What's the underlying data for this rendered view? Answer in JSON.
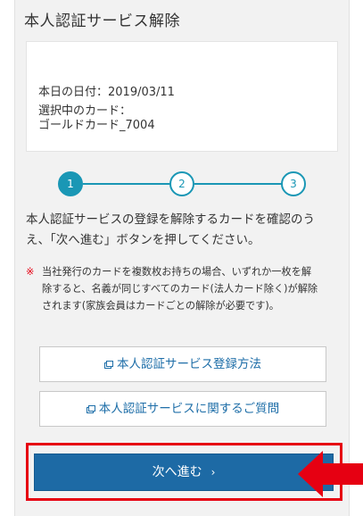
{
  "page": {
    "title": "本人認証サービス解除"
  },
  "info": {
    "date_line": "本日の日付：2019/03/11",
    "card_label": "選択中のカード：",
    "card_name": "ゴールドカード_7004"
  },
  "steps": [
    {
      "label": "1",
      "active": true
    },
    {
      "label": "2",
      "active": false
    },
    {
      "label": "3",
      "active": false
    }
  ],
  "description": {
    "line1": "本人認証サービスの登録を解除するカードを確認のう",
    "line2": "え、「次へ進む」ボタンを押してください。"
  },
  "note": {
    "mark": "※",
    "line1": "当社発行のカードを複数枚お持ちの場合、いずれか一枚を解",
    "line2": "除すると、名義が同じすべてのカード(法人カード除く)が解除",
    "line3": "されます(家族会員はカードごとの解除が必要です)。"
  },
  "links": {
    "registration_method": "本人認証サービス登録方法",
    "faq": "本人認証サービスに関するご質問"
  },
  "actions": {
    "next_label": "次へ進む",
    "next_chevron": "›"
  },
  "colors": {
    "accent": "#1a97b5",
    "primary_button": "#1d6aa5",
    "link": "#1e6ea8",
    "highlight": "#e60012",
    "panel_background": "#f2f2f2"
  },
  "icons": {
    "link_icon": "external-window-icon",
    "pointer_icon": "red-arrow-icon"
  }
}
